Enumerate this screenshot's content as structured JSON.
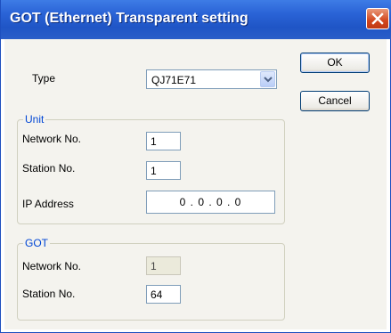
{
  "window": {
    "title": "GOT (Ethernet) Transparent setting"
  },
  "type": {
    "label": "Type",
    "value": "QJ71E71"
  },
  "buttons": {
    "ok": "OK",
    "cancel": "Cancel"
  },
  "unit": {
    "legend": "Unit",
    "network_label": "Network No.",
    "network_value": "1",
    "station_label": "Station No.",
    "station_value": "1",
    "ip_label": "IP Address",
    "ip_value": "0 . 0 . 0 . 0"
  },
  "got": {
    "legend": "GOT",
    "network_label": "Network No.",
    "network_value": "1",
    "station_label": "Station No.",
    "station_value": "64"
  },
  "icons": {
    "close": "close-icon",
    "dropdown": "chevron-down-icon"
  },
  "colors": {
    "titlebar": "#2a63d6",
    "legend": "#0046d5",
    "close": "#d2461e"
  }
}
